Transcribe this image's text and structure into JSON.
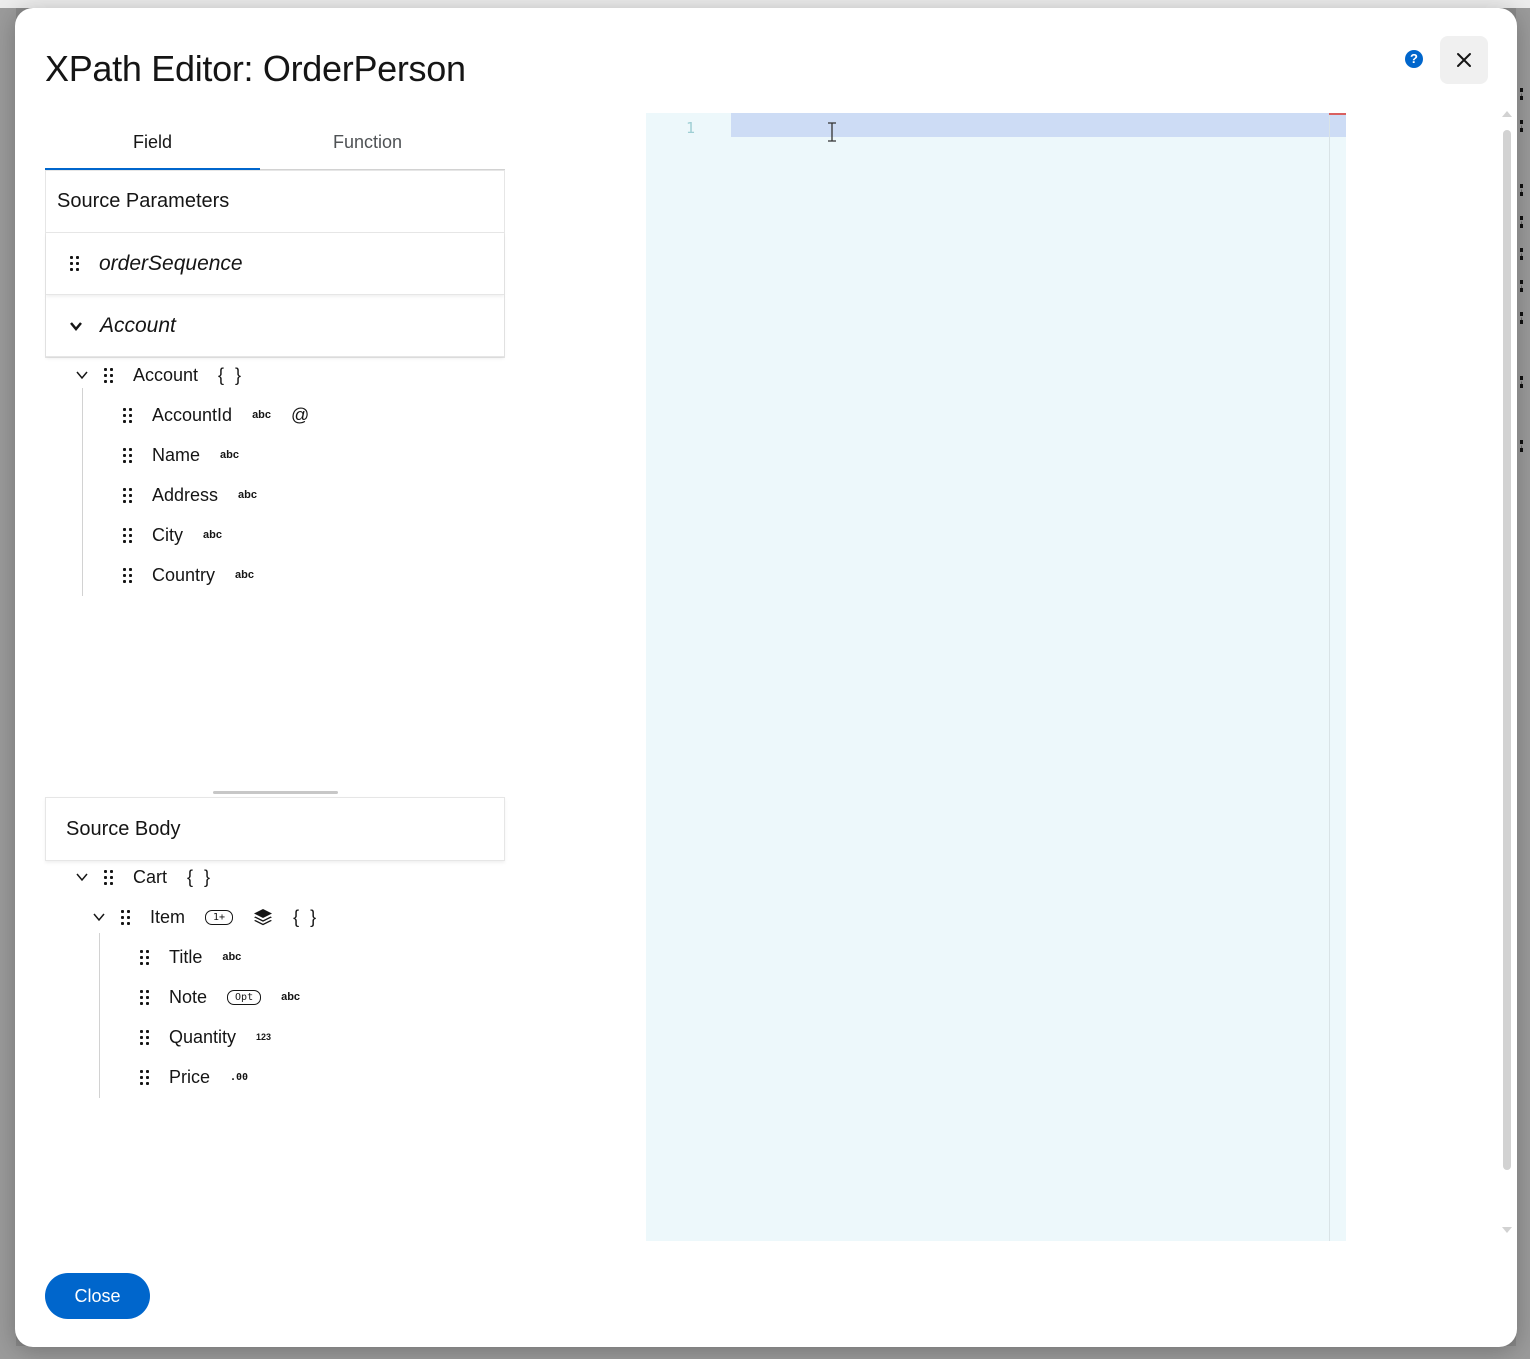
{
  "modal": {
    "title": "XPath Editor: OrderPerson",
    "close_label": "Close"
  },
  "tabs": [
    {
      "label": "Field",
      "active": true
    },
    {
      "label": "Function",
      "active": false
    }
  ],
  "source_parameters": {
    "header": "Source Parameters",
    "params": [
      "orderSequence",
      "Account"
    ],
    "tree": {
      "root": {
        "label": "Account",
        "type": "{ }"
      },
      "fields": [
        {
          "label": "AccountId",
          "type": "abc",
          "extra": "@"
        },
        {
          "label": "Name",
          "type": "abc"
        },
        {
          "label": "Address",
          "type": "abc"
        },
        {
          "label": "City",
          "type": "abc"
        },
        {
          "label": "Country",
          "type": "abc"
        }
      ]
    }
  },
  "source_body": {
    "header": "Source Body",
    "root": {
      "label": "Cart",
      "type": "{ }"
    },
    "item": {
      "label": "Item",
      "badge": "1+",
      "type": "{ }"
    },
    "fields": [
      {
        "label": "Title",
        "type": "abc"
      },
      {
        "label": "Note",
        "badge": "Opt",
        "type": "abc"
      },
      {
        "label": "Quantity",
        "type": "123"
      },
      {
        "label": "Price",
        "type": ".00"
      }
    ]
  },
  "editor": {
    "line_number": "1"
  },
  "colors": {
    "accent": "#0066cc",
    "editor_bg": "#edf8fb",
    "line_highlight": "#cddcf5"
  },
  "icons": [
    "help-icon",
    "close-icon",
    "drag-handle-icon",
    "chevron-down-icon",
    "layers-icon",
    "text-cursor-icon"
  ]
}
